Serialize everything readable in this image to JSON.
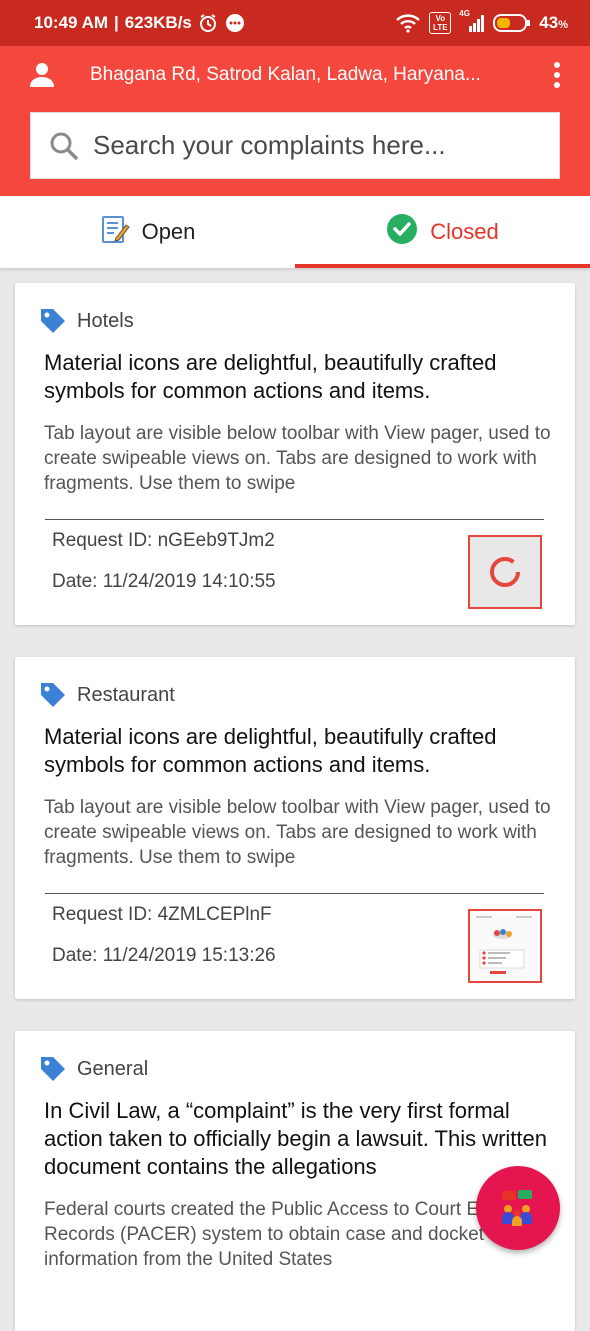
{
  "status_bar": {
    "time": "10:49 AM",
    "network_speed": "623KB/s",
    "battery": "43",
    "battery_unit": "%",
    "volte_label": "Vo LTE",
    "net_type": "4G"
  },
  "header": {
    "location": "Bhagana Rd, Satrod Kalan, Ladwa, Haryana...",
    "search_placeholder": "Search your complaints here..."
  },
  "tabs": [
    {
      "label": "Open",
      "active": false
    },
    {
      "label": "Closed",
      "active": true
    }
  ],
  "complaints": [
    {
      "category": "Hotels",
      "title": "Material icons are delightful, beautifully crafted symbols for common actions and items.",
      "description": "Tab layout are visible below toolbar with View pager, used to create swipeable views on. Tabs are designed to work with fragments. Use them to swipe",
      "request_label": "Request ID:",
      "request_id": "nGEeb9TJm2",
      "date_label": "Date:",
      "date": "11/24/2019 14:10:55"
    },
    {
      "category": "Restaurant",
      "title": "Material icons are delightful, beautifully crafted symbols for common actions and items.",
      "description": "Tab layout are visible below toolbar with View pager, used to create swipeable views on. Tabs are designed to work with fragments. Use them to swipe",
      "request_label": "Request ID:",
      "request_id": "4ZMLCEPlnF",
      "date_label": "Date:",
      "date": "11/24/2019 15:13:26"
    },
    {
      "category": "General",
      "title": "In Civil Law, a “complaint” is the very first formal action taken to officially begin a lawsuit. This written document contains the allegations",
      "description": "Federal courts created the Public Access to Court Electronic Records (PACER) system to obtain case and docket information from the United States"
    }
  ],
  "colors": {
    "status_bar": "#c92a20",
    "app_bar": "#f4473d",
    "accent": "#e5332a",
    "fab": "#e5164f",
    "tag": "#3b82d6"
  }
}
